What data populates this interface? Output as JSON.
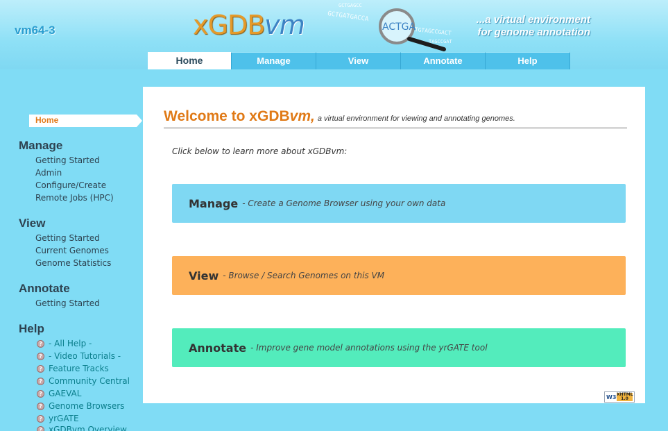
{
  "header": {
    "vm_name": "vm64-3",
    "logo_main": "xGDB",
    "logo_suffix": "vm",
    "tagline_line1": "...a virtual environment",
    "tagline_line2": "for genome annotation",
    "sequence_fragments": [
      "ACTGA",
      "GCTGATGACCA",
      "GCTGTAGCCGACT",
      "GCTGAGCC",
      "TAGCCGAT"
    ]
  },
  "tabs": [
    {
      "label": "Home",
      "active": true
    },
    {
      "label": "Manage",
      "active": false
    },
    {
      "label": "View",
      "active": false
    },
    {
      "label": "Annotate",
      "active": false
    },
    {
      "label": "Help",
      "active": false
    }
  ],
  "sidebar": {
    "current": "Home",
    "sections": [
      {
        "title": "Manage",
        "items": [
          "Getting Started",
          "Admin",
          "Configure/Create",
          "Remote Jobs (HPC)"
        ]
      },
      {
        "title": "View",
        "items": [
          "Getting Started",
          "Current Genomes",
          "Genome Statistics"
        ]
      },
      {
        "title": "Annotate",
        "items": [
          "Getting Started"
        ]
      }
    ],
    "help": {
      "title": "Help",
      "items": [
        "- All Help -",
        "- Video Tutorials -",
        "Feature Tracks",
        "Community Central",
        "GAEVAL",
        "Genome Browsers",
        "yrGATE",
        "xGDBvm Overview"
      ]
    }
  },
  "main": {
    "welcome_prefix": "Welcome to xGDB",
    "welcome_vm": "vm,",
    "welcome_sub": "a virtual environment for viewing and annotating genomes.",
    "intro": "Click below to learn more about xGDBvm:",
    "cards": [
      {
        "title": "Manage",
        "desc": "- Create a Genome Browser using your own data",
        "color": "#7fd8f3"
      },
      {
        "title": "View",
        "desc": "- Browse / Search Genomes on this VM",
        "color": "#fdb15a"
      },
      {
        "title": "Annotate",
        "desc": "- Improve gene model annotations using the yrGATE tool",
        "color": "#53ecbc"
      }
    ],
    "badge": {
      "w3c": "W3C",
      "xhtml": "XHTML 1.0"
    }
  },
  "colors": {
    "accent_orange": "#e07a17",
    "background": "#80dcf5",
    "tab": "#4ec1ea"
  }
}
